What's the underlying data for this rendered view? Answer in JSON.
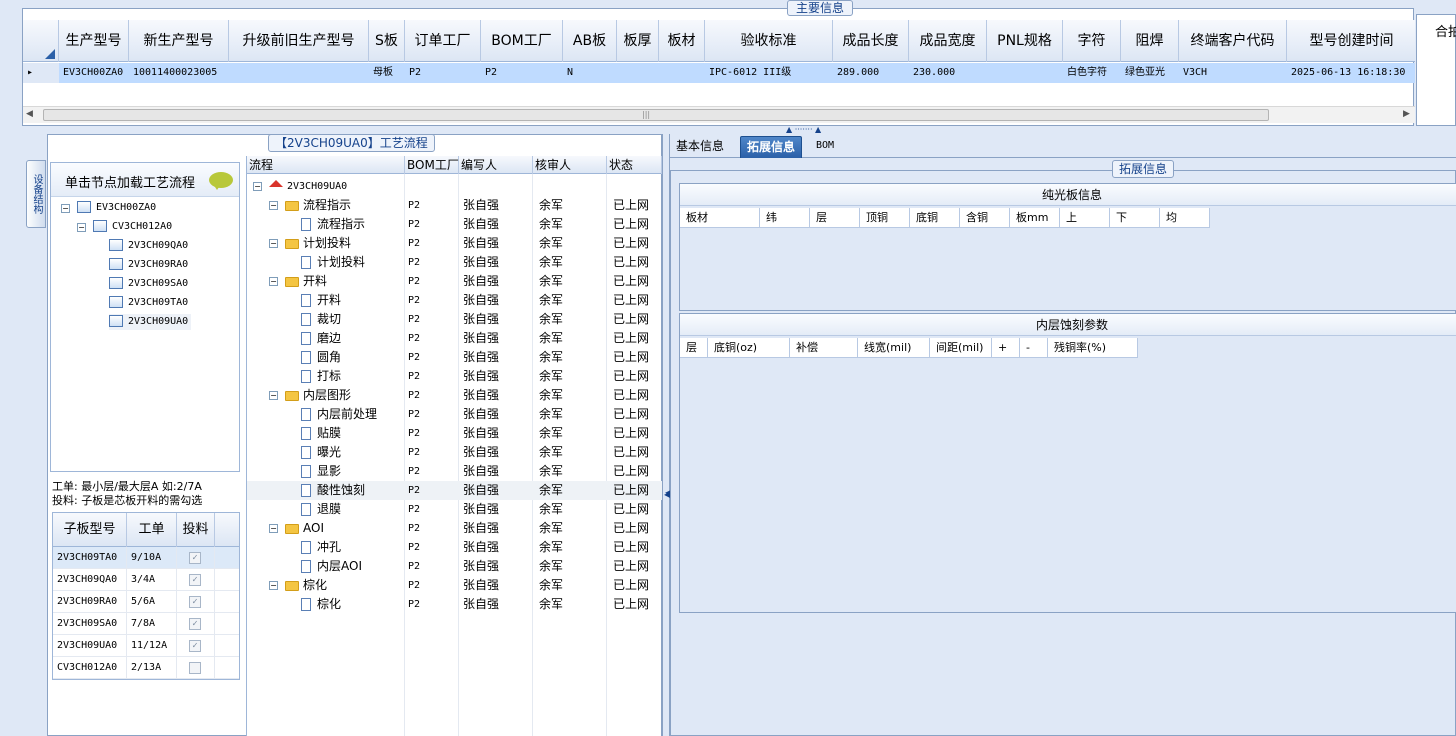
{
  "main_info": {
    "legend": "主要信息",
    "right_header": "合拍",
    "columns": [
      "生产型号",
      "新生产型号",
      "升级前旧生产型号",
      "S板",
      "订单工厂",
      "BOM工厂",
      "AB板",
      "板厚",
      "板材",
      "验收标准",
      "成品长度",
      "成品宽度",
      "PNL规格",
      "字符",
      "阻焊",
      "终端客户代码",
      "型号创建时间"
    ],
    "row": [
      "EV3CH00ZA0",
      "10011400023005",
      "",
      "母板",
      "P2",
      "P2",
      "N",
      "",
      "",
      "IPC-6012 III级",
      "289.000",
      "230.000",
      "",
      "白色字符",
      "绿色亚光",
      "V3CH",
      "2025-06-13 16:18:30"
    ]
  },
  "flow": {
    "legend": "【2V3CH09UA0】工艺流程",
    "side_tab": "设备结构",
    "hint": "单击节点加载工艺流程",
    "tree": {
      "root": "EV3CH00ZA0",
      "child": "CV3CH012A0",
      "leaves": [
        "2V3CH09QA0",
        "2V3CH09RA0",
        "2V3CH09SA0",
        "2V3CH09TA0",
        "2V3CH09UA0"
      ]
    },
    "note_line1": "工单: 最小层/最大层A 如:2/7A",
    "note_line2": "投料: 子板是芯板开料的需勾选",
    "sub_table": {
      "headers": [
        "子板型号",
        "工单",
        "投料"
      ],
      "rows": [
        {
          "model": "2V3CH09TA0",
          "order": "9/10A",
          "checked": "✓"
        },
        {
          "model": "2V3CH09QA0",
          "order": "3/4A",
          "checked": "✓"
        },
        {
          "model": "2V3CH09RA0",
          "order": "5/6A",
          "checked": "✓"
        },
        {
          "model": "2V3CH09SA0",
          "order": "7/8A",
          "checked": "✓"
        },
        {
          "model": "2V3CH09UA0",
          "order": "11/12A",
          "checked": "✓"
        },
        {
          "model": "CV3CH012A0",
          "order": "2/13A",
          "checked": ""
        }
      ]
    },
    "grid_headers": [
      "流程",
      "BOM工厂",
      "编写人",
      "核审人",
      "状态"
    ],
    "root_label": "2V3CH09UA0",
    "rows": [
      {
        "name": "流程指示",
        "level": 1,
        "factory": "P2",
        "writer": "张自强",
        "checker": "余军",
        "status": "已上网"
      },
      {
        "name": "流程指示",
        "level": 2,
        "factory": "P2",
        "writer": "张自强",
        "checker": "余军",
        "status": "已上网"
      },
      {
        "name": "计划投料",
        "level": 1,
        "factory": "P2",
        "writer": "张自强",
        "checker": "余军",
        "status": "已上网"
      },
      {
        "name": "计划投料",
        "level": 2,
        "factory": "P2",
        "writer": "张自强",
        "checker": "余军",
        "status": "已上网"
      },
      {
        "name": "开料",
        "level": 1,
        "factory": "P2",
        "writer": "张自强",
        "checker": "余军",
        "status": "已上网"
      },
      {
        "name": "开料",
        "level": 2,
        "factory": "P2",
        "writer": "张自强",
        "checker": "余军",
        "status": "已上网"
      },
      {
        "name": "裁切",
        "level": 2,
        "factory": "P2",
        "writer": "张自强",
        "checker": "余军",
        "status": "已上网"
      },
      {
        "name": "磨边",
        "level": 2,
        "factory": "P2",
        "writer": "张自强",
        "checker": "余军",
        "status": "已上网"
      },
      {
        "name": "圆角",
        "level": 2,
        "factory": "P2",
        "writer": "张自强",
        "checker": "余军",
        "status": "已上网"
      },
      {
        "name": "打标",
        "level": 2,
        "factory": "P2",
        "writer": "张自强",
        "checker": "余军",
        "status": "已上网"
      },
      {
        "name": "内层图形",
        "level": 1,
        "factory": "P2",
        "writer": "张自强",
        "checker": "余军",
        "status": "已上网"
      },
      {
        "name": "内层前处理",
        "level": 2,
        "factory": "P2",
        "writer": "张自强",
        "checker": "余军",
        "status": "已上网"
      },
      {
        "name": "贴膜",
        "level": 2,
        "factory": "P2",
        "writer": "张自强",
        "checker": "余军",
        "status": "已上网"
      },
      {
        "name": "曝光",
        "level": 2,
        "factory": "P2",
        "writer": "张自强",
        "checker": "余军",
        "status": "已上网"
      },
      {
        "name": "显影",
        "level": 2,
        "factory": "P2",
        "writer": "张自强",
        "checker": "余军",
        "status": "已上网"
      },
      {
        "name": "酸性蚀刻",
        "level": 2,
        "factory": "P2",
        "writer": "张自强",
        "checker": "余军",
        "status": "已上网"
      },
      {
        "name": "退膜",
        "level": 2,
        "factory": "P2",
        "writer": "张自强",
        "checker": "余军",
        "status": "已上网"
      },
      {
        "name": "AOI",
        "level": 1,
        "factory": "P2",
        "writer": "张自强",
        "checker": "余军",
        "status": "已上网"
      },
      {
        "name": "冲孔",
        "level": 2,
        "factory": "P2",
        "writer": "张自强",
        "checker": "余军",
        "status": "已上网"
      },
      {
        "name": "内层AOI",
        "level": 2,
        "factory": "P2",
        "writer": "张自强",
        "checker": "余军",
        "status": "已上网"
      },
      {
        "name": "棕化",
        "level": 1,
        "factory": "P2",
        "writer": "张自强",
        "checker": "余军",
        "status": "已上网"
      },
      {
        "name": "棕化",
        "level": 2,
        "factory": "P2",
        "writer": "张自强",
        "checker": "余军",
        "status": "已上网"
      }
    ]
  },
  "right": {
    "tabs": [
      "基本信息",
      "拓展信息",
      "BOM"
    ],
    "legend": "拓展信息",
    "bare_board": {
      "title": "纯光板信息",
      "columns": [
        "板材",
        "纬",
        "层",
        "顶铜",
        "底铜",
        "含铜",
        "板mm",
        "上",
        "下",
        "均"
      ]
    },
    "inner_etch": {
      "title": "内层蚀刻参数",
      "columns": [
        "层",
        "底铜(oz)",
        "补偿",
        "线宽(mil)",
        "间距(mil)",
        "+",
        "-",
        "残铜率(%)"
      ]
    }
  }
}
